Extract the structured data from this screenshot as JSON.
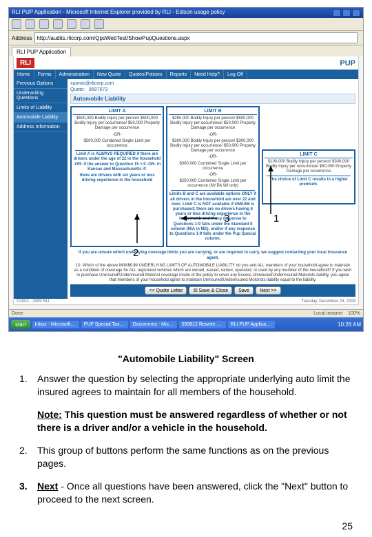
{
  "browser": {
    "title": "RLI PUP Application - Microsoft Internet Explorer provided by RLI - Edison usage policy",
    "address_label": "Address",
    "address_value": "http://audits.rlicorp.com/QpsWebTest/ShowPupQuestions.aspx",
    "tab_label": "RLI PUP Application"
  },
  "status": {
    "left": "Done",
    "zone": "Local intranet",
    "zoom": "100%"
  },
  "taskbar": {
    "start": "start",
    "items": [
      "Inbox - Microsoft Out…",
      "PUP Special Task Se…",
      "Documents - Micros…",
      "099812 Rewrite PUP…",
      "RLI PUP Application -…"
    ],
    "clock": "10:28 AM"
  },
  "app": {
    "logo": "RLI",
    "product": "PUP",
    "menu": [
      "Home",
      "Forms",
      "Administration",
      "New Quote",
      "Quotes/Policies",
      "Reports",
      "Need Help?",
      "Log Off"
    ],
    "sidenav": [
      "Previous Options",
      "Underwriting Questions",
      "Limits of Liability",
      "Automobile Liability",
      "Address Information"
    ],
    "crumbs_user": "suomis@rlicorp.com",
    "crumbs_quote_label": "Quote:",
    "crumbs_quote": "8597573",
    "section_title": "Automobile Liability",
    "limits": {
      "a": {
        "title": "LIMIT A",
        "line1": "$500,000 Bodily Injury per person/\n$500,000 Bodily Injury per occurrence/\n$50,000 Property Damage per occurrence",
        "or1": "-OR-",
        "line2": "$500,000 Combined Single Limit per occurrence",
        "req": "Limit A is ALWAYS REQUIRED if there are drivers under the age of 22 in the household -OR- if the answer to Question 15 > 0 -OR- in Kansas and Massachusetts if:",
        "req2": "there are drivers with six years or less driving experience in the household"
      },
      "b": {
        "title": "LIMIT B",
        "line1": "$250,000 Bodily Injury per person/\n$500,000 Bodily Injury per occurrence/\n$50,000 Property Damage per occurrence",
        "or1": "-OR-",
        "line2": "$300,000 Bodily Injury per person/\n$300,000 Bodily Injury per occurrence/\n$50,000 Property Damage per occurrence",
        "or2": "-OR-",
        "line3": "$300,000 Combined Single Limit per occurrence",
        "or3": "-OR-",
        "line4": "$250,000 Combined Single Limit per occurrence (NY,PA,WI only)",
        "footer": "Limits B and C are available options ONLY if all drivers in the household are over 22 and over; Limit C is NOT available if UM/UIM is purchased; there are no drivers having 6 years or less driving experience in the household; and if any response to Questions 1-9 falls under the Standard II column (N/A in ME); and/or if any response to Questions 1-9 falls under the Pup Special column."
      },
      "c": {
        "title": "LIMIT C",
        "line1": "$100,000 Bodily Injury per person/\n$300,000 Bodily Injury per occurrence/\n$50,000 Property Damage per occurrence",
        "note": "The choice of Limit C results in a higher premium."
      }
    },
    "question": "If you are unsure which underlying coverage limits you are carrying, or are required to carry, we suggest contacting your local insurance agent.",
    "disclaimer": "10. Which of the above MINIMUM UNDERLYING LIMITS OF AUTOMOBILE LIABILITY do you and ALL members of your household agree to maintain as a condition of coverage for ALL registered vehicles which are owned, leased, rented, operated, or used by any member of the household? If you wish to purchase Uninsured/Underinsured Motorist coverage inside of the policy to cover any Excess Uninsured/Underinsured Motorists liability, you agree that members of your household agree to maintain Uninsured/Underinsured Motorists liability equal to the liability.",
    "buttons": {
      "quote_letter": "<< Quote Letter",
      "save_close": "☒ Save & Close",
      "save": "Save",
      "next": "Next >>"
    },
    "copyright_left": "©2002 - 2009 RLI",
    "copyright_right": "Tuesday, December 29, 2009"
  },
  "callouts": {
    "c1": "1",
    "c2": "2",
    "c3": "3"
  },
  "document": {
    "title": "\"Automobile Liability\" Screen",
    "items": [
      {
        "num": "1.",
        "text": "Answer the question by selecting the appropriate underlying auto limit the insured agrees to maintain for all members of the household."
      },
      {
        "num": "2.",
        "text": "This group of buttons perform the same functions as on the previous pages."
      },
      {
        "num": "3.",
        "num_bold": true,
        "lead": "Next",
        "text": " - Once all questions have been answered, click the \"Next\" button to proceed to the next screen."
      }
    ],
    "note_lead": "Note:",
    "note_body": " This question must be answered regardless of whether or not there is a driver and/or a vehicle in the household.",
    "page": "25"
  }
}
